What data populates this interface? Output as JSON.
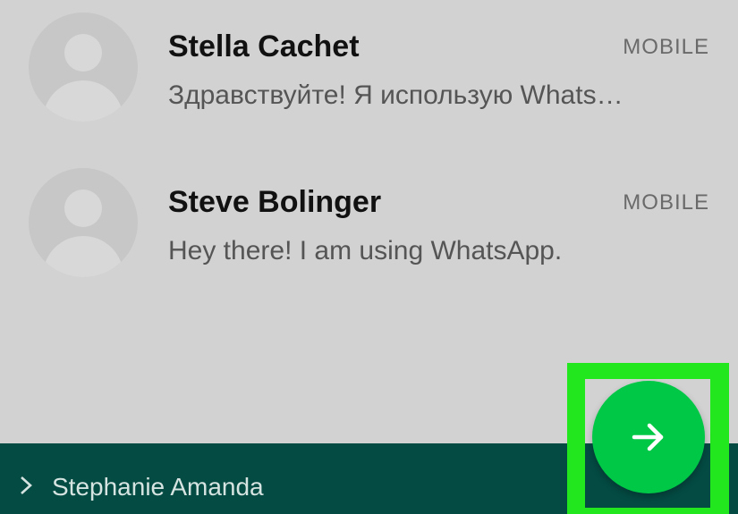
{
  "contacts": [
    {
      "name": "Stella Cachet",
      "type": "MOBILE",
      "status": "Здравствуйте! Я использую Whats…"
    },
    {
      "name": "Steve Bolinger",
      "type": "MOBILE",
      "status": "Hey there! I am using WhatsApp."
    }
  ],
  "selected": {
    "name": "Stephanie Amanda"
  },
  "icons": {
    "avatar": "default-avatar-icon",
    "chevron": "chevron-right-icon",
    "next": "arrow-right-icon"
  },
  "colors": {
    "background": "#d2d2d2",
    "selected_bar": "#044b43",
    "fab": "#00c847",
    "highlight": "#22e61e"
  }
}
